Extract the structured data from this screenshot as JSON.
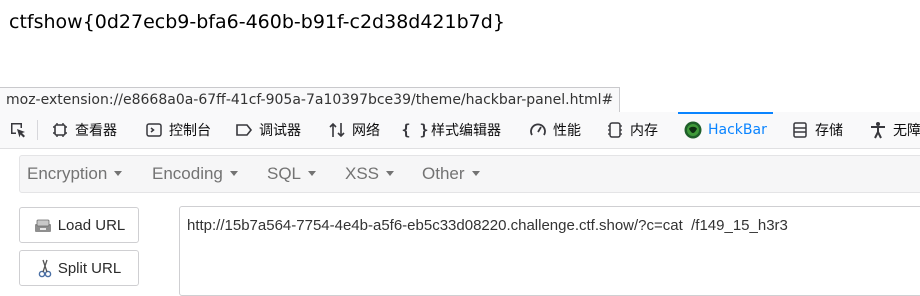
{
  "page": {
    "flag_text": "ctfshow{0d27ecb9-bfa6-460b-b91f-c2d38d421b7d}"
  },
  "status_bar": {
    "url": "moz-extension://e8668a0a-67ff-41cf-905a-7a10397bce39/theme/hackbar-panel.html#"
  },
  "devtools": {
    "tabs": [
      {
        "label": "查看器",
        "icon": "inspector-icon"
      },
      {
        "label": "控制台",
        "icon": "console-icon"
      },
      {
        "label": "调试器",
        "icon": "debugger-icon"
      },
      {
        "label": "网络",
        "icon": "network-icon"
      },
      {
        "label": "样式编辑器",
        "icon": "style-editor-icon"
      },
      {
        "label": "性能",
        "icon": "performance-icon"
      },
      {
        "label": "内存",
        "icon": "memory-icon"
      },
      {
        "label": "HackBar",
        "icon": "hackbar-icon",
        "active": true
      },
      {
        "label": "存储",
        "icon": "storage-icon"
      },
      {
        "label": "无障",
        "icon": "accessibility-icon"
      }
    ],
    "accent": "#0a84ff"
  },
  "hackbar": {
    "menu": [
      {
        "label": "Encryption"
      },
      {
        "label": "Encoding"
      },
      {
        "label": "SQL"
      },
      {
        "label": "XSS"
      },
      {
        "label": "Other"
      }
    ],
    "buttons": {
      "load_url": "Load URL",
      "split_url": "Split URL"
    },
    "url_value": "http://15b7a564-7754-4e4b-a5f6-eb5c33d08220.challenge.ctf.show/?c=cat  /f149_15_h3r3"
  }
}
